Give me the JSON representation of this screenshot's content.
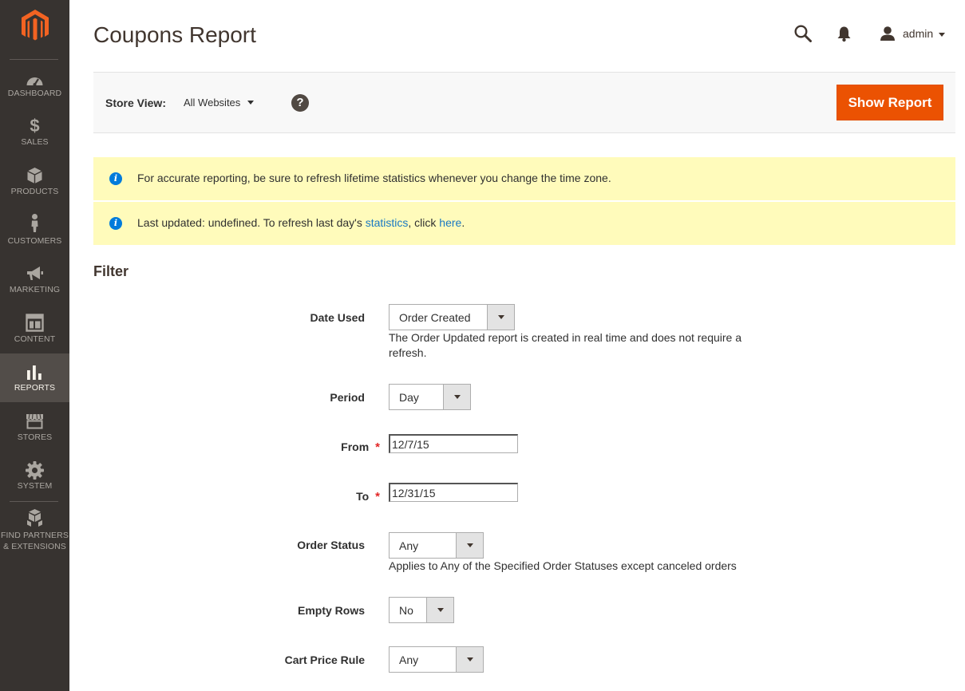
{
  "sidebar": {
    "items": [
      {
        "label": "DASHBOARD",
        "icon": "dashboard-icon"
      },
      {
        "label": "SALES",
        "icon": "dollar-icon"
      },
      {
        "label": "PRODUCTS",
        "icon": "cube-icon"
      },
      {
        "label": "CUSTOMERS",
        "icon": "person-icon"
      },
      {
        "label": "MARKETING",
        "icon": "megaphone-icon"
      },
      {
        "label": "CONTENT",
        "icon": "layout-icon"
      },
      {
        "label": "REPORTS",
        "icon": "bar-chart-icon",
        "active": true
      },
      {
        "label": "STORES",
        "icon": "storefront-icon"
      },
      {
        "label": "SYSTEM",
        "icon": "gear-icon"
      },
      {
        "label": "FIND PARTNERS",
        "label2": "& EXTENSIONS",
        "icon": "boxes-icon"
      }
    ]
  },
  "header": {
    "title": "Coupons Report",
    "user": "admin"
  },
  "toolbar": {
    "store_label": "Store View:",
    "store_value": "All Websites",
    "help_glyph": "?",
    "show_report": "Show Report"
  },
  "messages": {
    "first": "For accurate reporting, be sure to refresh lifetime statistics whenever you change the time zone.",
    "second_prefix": "Last updated: undefined. To refresh last day's ",
    "second_link1": "statistics",
    "second_mid": ", click ",
    "second_link2": "here",
    "second_suffix": "."
  },
  "filter": {
    "title": "Filter",
    "date_used": {
      "label": "Date Used",
      "value": "Order Created",
      "note": "The Order Updated report is created in real time and does not require a refresh."
    },
    "period": {
      "label": "Period",
      "value": "Day"
    },
    "from": {
      "label": "From",
      "value": "12/7/15",
      "required": "*"
    },
    "to": {
      "label": "To",
      "value": "12/31/15",
      "required": "*"
    },
    "order_status": {
      "label": "Order Status",
      "value": "Any",
      "note": "Applies to Any of the Specified Order Statuses except canceled orders"
    },
    "empty_rows": {
      "label": "Empty Rows",
      "value": "No"
    },
    "cart_price_rule": {
      "label": "Cart Price Rule",
      "value": "Any"
    }
  },
  "colors": {
    "sidebar_bg": "#373330",
    "accent": "#eb5202",
    "message_bg": "#fffbbb",
    "link": "#1979c3"
  }
}
